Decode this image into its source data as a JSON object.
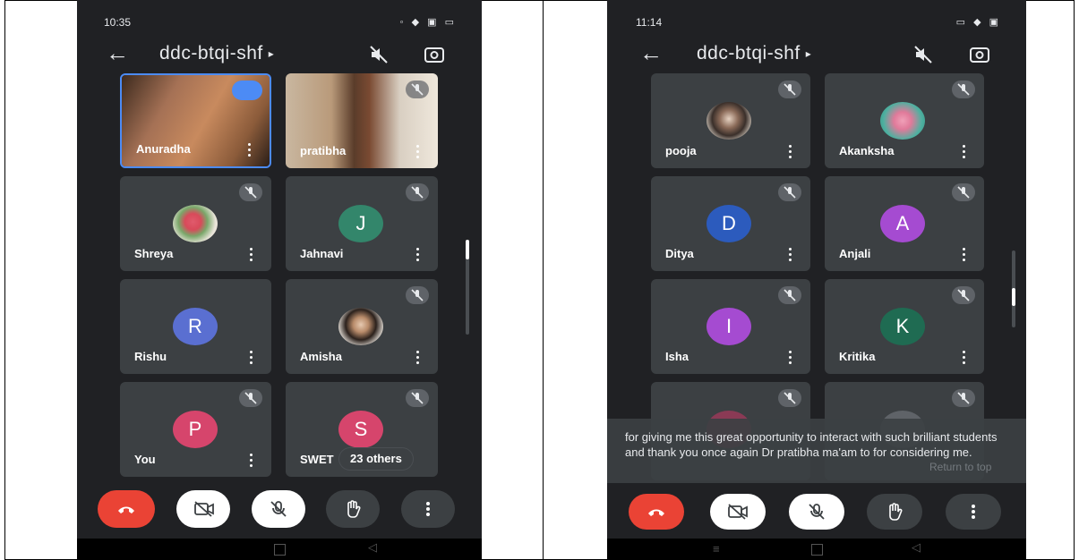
{
  "left": {
    "time": "10:35",
    "status_icons": "◦ ◆ ▣ ▭",
    "meeting_code": "ddc-btqi-shf",
    "participants": [
      {
        "name": "Anuradha",
        "type": "video"
      },
      {
        "name": "pratibha",
        "type": "video"
      },
      {
        "name": "Shreya",
        "type": "photo"
      },
      {
        "name": "Jahnavi",
        "initial": "J",
        "color": "#33866b"
      },
      {
        "name": "Rishu",
        "initial": "R",
        "color": "#5a6fd1"
      },
      {
        "name": "Amisha",
        "type": "photo"
      },
      {
        "name": "You",
        "initial": "P",
        "color": "#d6456c"
      },
      {
        "name": "SWET",
        "initial": "S",
        "color": "#d6456c"
      }
    ],
    "others_label": "23 others"
  },
  "right": {
    "time": "11:14",
    "status_icons": "▭ ◆ ▣",
    "meeting_code": "ddc-btqi-shf",
    "participants": [
      {
        "name": "pooja",
        "type": "photo"
      },
      {
        "name": "Akanksha",
        "type": "photo"
      },
      {
        "name": "Ditya",
        "initial": "D",
        "color": "#2c5bbd"
      },
      {
        "name": "Anjali",
        "initial": "A",
        "color": "#a54bd1"
      },
      {
        "name": "Isha",
        "initial": "I",
        "color": "#a54bd1"
      },
      {
        "name": "Kritika",
        "initial": "K",
        "color": "#1f6b52"
      }
    ],
    "caption": "for giving me this great opportunity to interact with such brilliant students and thank you once again Dr pratibha ma'am to for considering me.",
    "return_label": "Return to top"
  },
  "colors": {
    "background": "#202124",
    "tile": "#3c4043",
    "end_call": "#ea4335",
    "control": "#3c4043",
    "control_light": "#ffffff"
  },
  "icons": [
    "back-arrow-icon",
    "speaker-off-icon",
    "switch-camera-icon",
    "mic-off-icon",
    "more-vert-icon",
    "end-call-icon",
    "camera-off-icon",
    "raise-hand-icon"
  ]
}
